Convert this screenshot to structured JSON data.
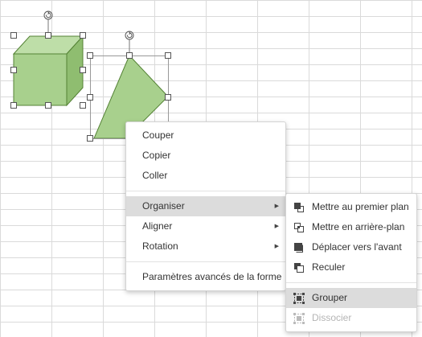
{
  "context_menu": {
    "items": [
      {
        "label": "Couper"
      },
      {
        "label": "Copier"
      },
      {
        "label": "Coller"
      },
      {
        "label": "Organiser"
      },
      {
        "label": "Aligner"
      },
      {
        "label": "Rotation"
      },
      {
        "label": "Paramètres avancés de la forme"
      }
    ],
    "highlighted": "Organiser"
  },
  "submenu": {
    "items": [
      {
        "label": "Mettre au premier plan",
        "icon": "bring-to-front-icon"
      },
      {
        "label": "Mettre en arrière-plan",
        "icon": "send-to-back-icon"
      },
      {
        "label": "Déplacer vers l'avant",
        "icon": "bring-forward-icon"
      },
      {
        "label": "Reculer",
        "icon": "send-backward-icon"
      },
      {
        "label": "Grouper",
        "icon": "group-icon",
        "highlighted": true
      },
      {
        "label": "Dissocier",
        "icon": "ungroup-icon",
        "disabled": true
      }
    ]
  },
  "colors": {
    "shape_fill": "#a8d08d",
    "shape_side": "#8fbd70",
    "shape_top": "#bedea8",
    "shape_stroke": "#548235",
    "grid": "#dadada",
    "menu_highlight": "#dcdcdc"
  }
}
